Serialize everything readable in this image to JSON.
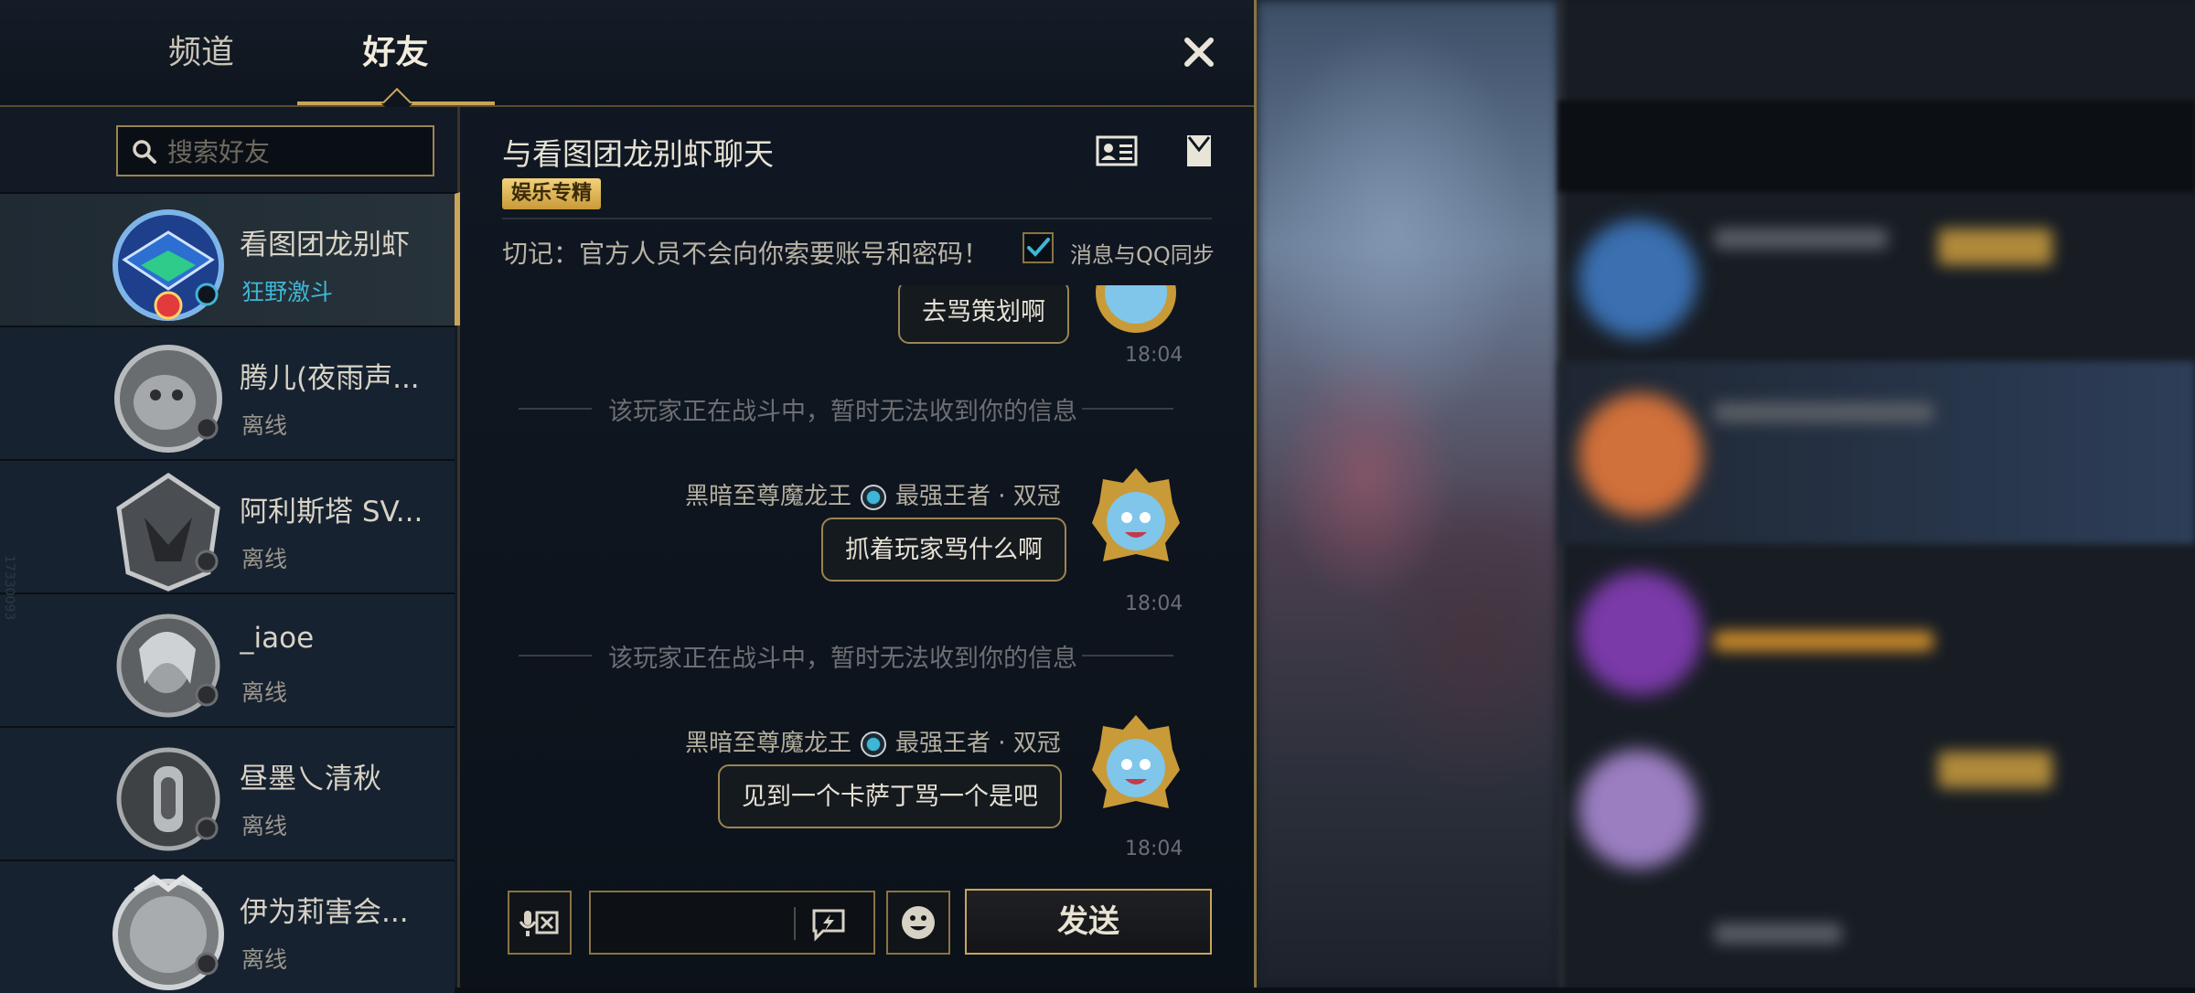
{
  "tabs": {
    "channel": "频道",
    "friends": "好友"
  },
  "search": {
    "placeholder": "搜索好友"
  },
  "friends": [
    {
      "name": "看图团龙别虾",
      "status": "狂野激斗"
    },
    {
      "name": "腾儿(夜雨声...",
      "status": "离线"
    },
    {
      "name": "阿利斯塔 SV...",
      "status": "离线"
    },
    {
      "name": "_iaoe",
      "status": "离线"
    },
    {
      "name": "昼墨乀清秋",
      "status": "离线"
    },
    {
      "name": "伊为莉害会...",
      "status": "离线"
    }
  ],
  "side_id": "17330093",
  "chat": {
    "title": "与看图团龙别虾聊天",
    "tag": "娱乐专精",
    "warning": "切记：官方人员不会向你索要账号和密码！",
    "qq_sync_label": "消息与QQ同步",
    "messages": [
      {
        "text": "去骂策划啊",
        "time": "18:04"
      },
      {
        "system": "该玩家正在战斗中，暂时无法收到你的信息"
      },
      {
        "sender": "黑暗至尊魔龙王",
        "rank": "最强王者 · 双冠",
        "text": "抓着玩家骂什么啊",
        "time": "18:04"
      },
      {
        "system": "该玩家正在战斗中，暂时无法收到你的信息"
      },
      {
        "sender": "黑暗至尊魔龙王",
        "rank": "最强王者 · 双冠",
        "text": "见到一个卡萨丁骂一个是吧",
        "time": "18:04"
      }
    ],
    "send_label": "发送"
  },
  "colors": {
    "gold": "#c9a55a",
    "online": "#3fb6d6",
    "tag_bg": "#f3d27c"
  }
}
